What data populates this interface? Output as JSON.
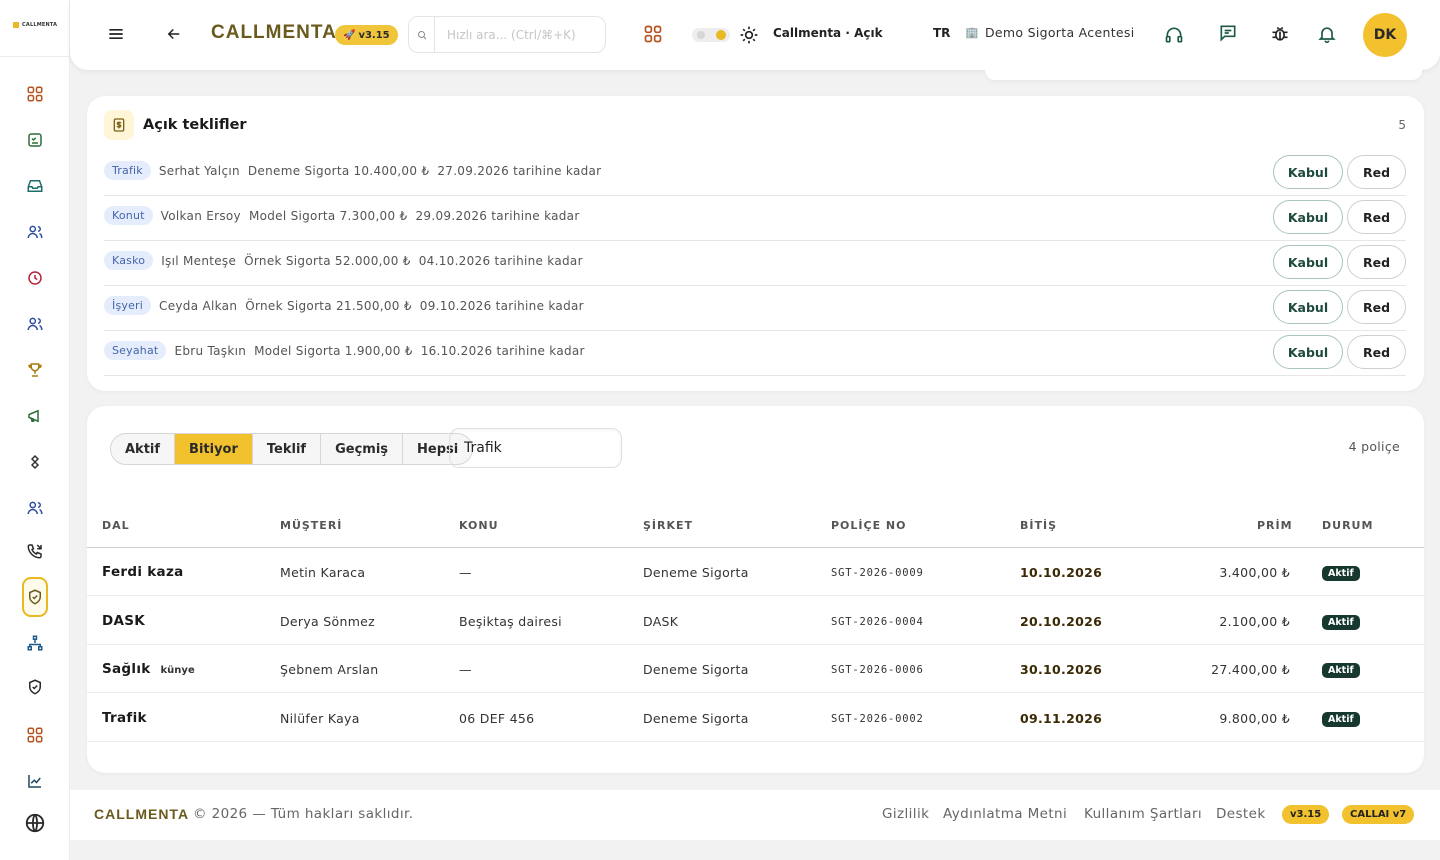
{
  "app": {
    "brand": "CALLMENTA",
    "logo_text": "CALLMENTA",
    "version": "v3.15",
    "theme_label": "Callmenta · Açık",
    "language": "TR",
    "agency": "Demo Sigorta Acentesi",
    "avatar_initials": "DK",
    "accent_color": "#f2c12e"
  },
  "search": {
    "placeholder": "Hızlı ara... (Ctrl/⌘+K)",
    "value": ""
  },
  "sidebar": {
    "icons": [
      "dashboard-icon",
      "tasks-icon",
      "inbox-icon",
      "customers-icon",
      "clock-icon",
      "team-icon",
      "trophy-icon",
      "megaphone-icon",
      "integrations-icon",
      "users-icon",
      "calls-icon",
      "policies-icon",
      "org-icon",
      "shield-icon",
      "apps-icon",
      "chart-icon",
      "globe-icon"
    ],
    "active_item": "policies-icon"
  },
  "offers": {
    "title": "Açık teklifler",
    "count": "5",
    "accept_label": "Kabul",
    "reject_label": "Red",
    "rows": [
      {
        "dal": "Trafik",
        "customer": "Serhat Yalçın",
        "company": "Deneme Sigorta",
        "amount": "10.400,00 ₺",
        "valid": "27.09.2026 tarihine kadar"
      },
      {
        "dal": "Konut",
        "customer": "Volkan Ersoy",
        "company": "Model Sigorta",
        "amount": "7.300,00 ₺",
        "valid": "29.09.2026 tarihine kadar"
      },
      {
        "dal": "Kasko",
        "customer": "Işıl Menteşe",
        "company": "Örnek Sigorta",
        "amount": "52.000,00 ₺",
        "valid": "04.10.2026 tarihine kadar"
      },
      {
        "dal": "İşyeri",
        "customer": "Ceyda Alkan",
        "company": "Örnek Sigorta",
        "amount": "21.500,00 ₺",
        "valid": "09.10.2026 tarihine kadar"
      },
      {
        "dal": "Seyahat",
        "customer": "Ebru Taşkın",
        "company": "Model Sigorta",
        "amount": "1.900,00 ₺",
        "valid": "16.10.2026 tarihine kadar"
      }
    ]
  },
  "policies": {
    "tabs": [
      "Aktif",
      "Bitiyor",
      "Teklif",
      "Geçmiş",
      "Hepsi"
    ],
    "active_tab": "Bitiyor",
    "filter_value": "Trafik",
    "count": "4 poliçe",
    "columns": [
      "DAL",
      "MÜŞTERİ",
      "KONU",
      "ŞİRKET",
      "POLİÇE NO",
      "BİTİŞ",
      "PRİM",
      "DURUM"
    ],
    "rows": [
      {
        "dal": "Ferdi kaza",
        "tag": "",
        "customer": "Metin Karaca",
        "subject": "—",
        "company": "Deneme Sigorta",
        "policy_no": "SGT-2026-0009",
        "end": "10.10.2026",
        "premium": "3.400,00 ₺",
        "status": "Aktif"
      },
      {
        "dal": "DASK",
        "tag": "",
        "customer": "Derya Sönmez",
        "subject": "Beşiktaş dairesi",
        "company": "DASK",
        "policy_no": "SGT-2026-0004",
        "end": "20.10.2026",
        "premium": "2.100,00 ₺",
        "status": "Aktif"
      },
      {
        "dal": "Sağlık",
        "tag": "künye",
        "customer": "Şebnem Arslan",
        "subject": "—",
        "company": "Deneme Sigorta",
        "policy_no": "SGT-2026-0006",
        "end": "30.10.2026",
        "premium": "27.400,00 ₺",
        "status": "Aktif"
      },
      {
        "dal": "Trafik",
        "tag": "",
        "customer": "Nilüfer Kaya",
        "subject": "06 DEF 456",
        "company": "Deneme Sigorta",
        "policy_no": "SGT-2026-0002",
        "end": "09.11.2026",
        "premium": "9.800,00 ₺",
        "status": "Aktif"
      }
    ]
  },
  "footer": {
    "brand": "CALLMENTA",
    "copyright": "© 2026 — Tüm hakları saklıdır.",
    "links": [
      "Gizlilik",
      "Aydınlatma Metni",
      "Kullanım Şartları",
      "Destek"
    ],
    "version": "v3.15",
    "ai_badge": "CALLAI v7"
  }
}
